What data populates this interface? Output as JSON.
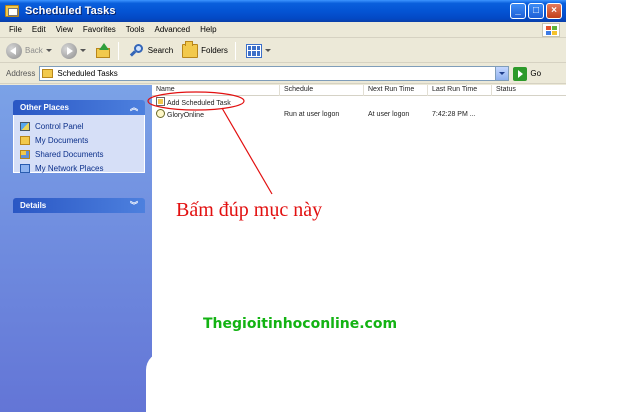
{
  "window": {
    "title": "Scheduled Tasks",
    "buttons": {
      "minimize": "_",
      "maximize": "□",
      "close": "×"
    }
  },
  "menubar": [
    "File",
    "Edit",
    "View",
    "Favorites",
    "Tools",
    "Advanced",
    "Help"
  ],
  "toolbar": {
    "back": "Back",
    "search": "Search",
    "folders": "Folders"
  },
  "address": {
    "label": "Address",
    "value": "Scheduled Tasks",
    "go": "Go"
  },
  "sidebar": {
    "other_places": {
      "title": "Other Places",
      "items": [
        {
          "label": "Control Panel",
          "icon": "control-panel-icon"
        },
        {
          "label": "My Documents",
          "icon": "my-documents-icon"
        },
        {
          "label": "Shared Documents",
          "icon": "shared-documents-icon"
        },
        {
          "label": "My Network Places",
          "icon": "network-places-icon"
        }
      ]
    },
    "details": {
      "title": "Details"
    }
  },
  "list": {
    "columns": [
      "Name",
      "Schedule",
      "Next Run Time",
      "Last Run Time",
      "Status"
    ],
    "rows": [
      {
        "name": "Add Scheduled Task",
        "schedule": "",
        "next": "",
        "last": "",
        "status": ""
      },
      {
        "name": "GloryOnline",
        "schedule": "Run at user logon",
        "next": "At user logon",
        "last": "7:42:28 PM ...",
        "status": ""
      }
    ]
  },
  "annotation": {
    "text": "Bấm đúp mục này",
    "color": "#e21010"
  },
  "watermark": {
    "text": "Thegioitinhoconline.com",
    "color": "#13b313"
  },
  "colors": {
    "titlebar": "#0454d4",
    "sidebar": "#7ba2e7",
    "annotation": "#e21010",
    "watermark": "#13b313"
  }
}
